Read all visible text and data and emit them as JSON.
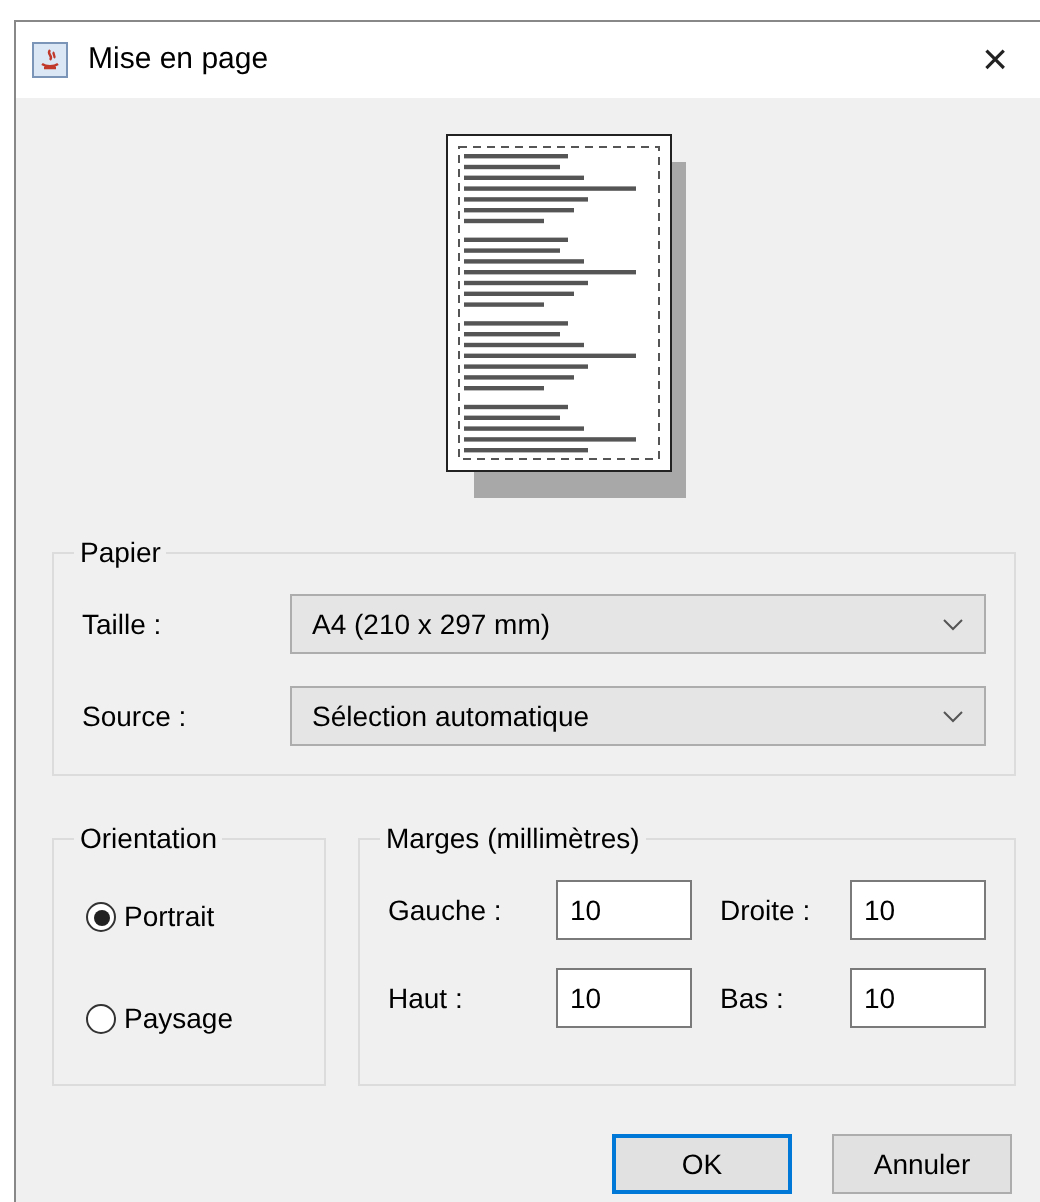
{
  "window": {
    "title": "Mise en page",
    "close": "×"
  },
  "paper": {
    "legend": "Papier",
    "fields": [
      {
        "label": "Taille :",
        "value": "A4 (210 x 297 mm)"
      },
      {
        "label": "Source :",
        "value": "Sélection automatique"
      }
    ]
  },
  "orientation": {
    "legend": "Orientation",
    "options": [
      {
        "label": "Portrait",
        "selected": true
      },
      {
        "label": "Paysage",
        "selected": false
      }
    ]
  },
  "margins": {
    "legend": "Marges (millimètres)",
    "fields": [
      {
        "label": "Gauche :",
        "value": "10"
      },
      {
        "label": "Droite :",
        "value": "10"
      },
      {
        "label": "Haut :",
        "value": "10"
      },
      {
        "label": "Bas :",
        "value": "10"
      }
    ]
  },
  "buttons": [
    {
      "label": "OK",
      "default": true
    },
    {
      "label": "Annuler",
      "default": false
    }
  ]
}
